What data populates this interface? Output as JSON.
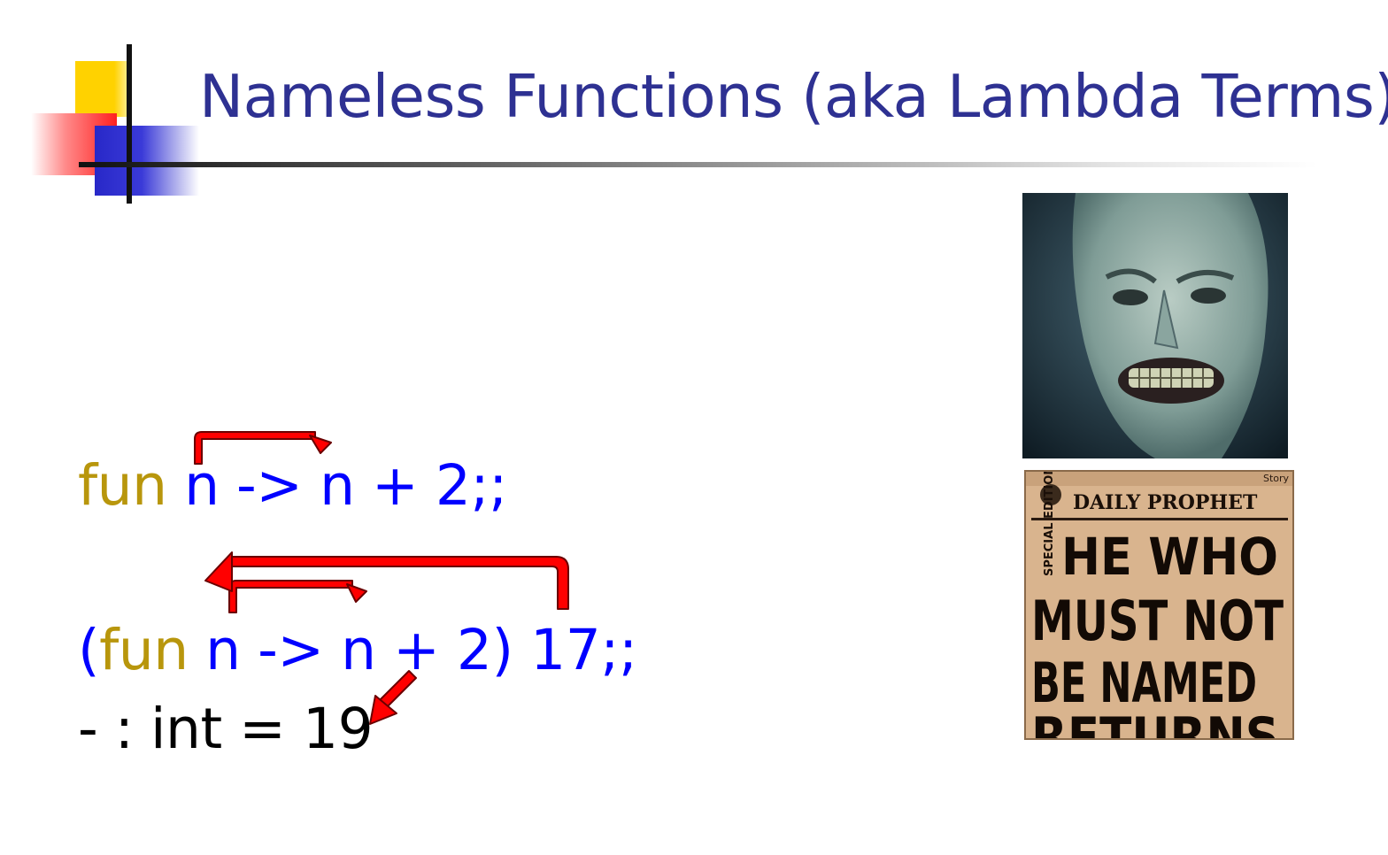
{
  "slide": {
    "title": "Nameless Functions (aka Lambda Terms)"
  },
  "code": {
    "line1": {
      "kw": "fun",
      "rest": " n -> n + 2;;"
    },
    "line2": {
      "open": "(",
      "kw": "fun",
      "rest": " n -> n + 2) 17;;"
    },
    "line3": {
      "text": "- : int = 19"
    }
  },
  "newspaper": {
    "masthead": "DAILY PROPHET",
    "edition": "SPECIAL EDITION",
    "headline_1": "HE WHO",
    "headline_2": "MUST NOT",
    "headline_3": "BE NAMED",
    "headline_4": "RETURNS",
    "corner": "Story"
  },
  "colors": {
    "title": "#2e3192",
    "keyword": "#b8960c",
    "code": "#0000ff",
    "output": "#000000",
    "arrow": "#ff0000"
  }
}
